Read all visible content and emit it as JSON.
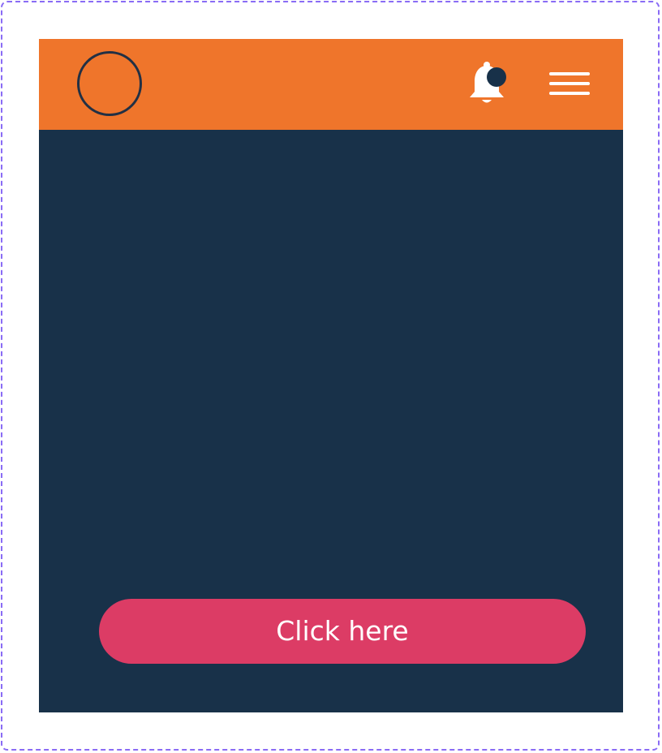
{
  "header": {
    "avatar_icon": "avatar-circle-icon",
    "notification_icon": "bell-icon",
    "notification_badge": "dot",
    "menu_icon": "hamburger-menu-icon"
  },
  "main": {
    "button_label": "Click here"
  },
  "colors": {
    "header_bg": "#ef752b",
    "content_bg": "#183149",
    "button_bg": "#dc3c65",
    "frame_border": "#8a6cf5",
    "icon": "#ffffff"
  }
}
